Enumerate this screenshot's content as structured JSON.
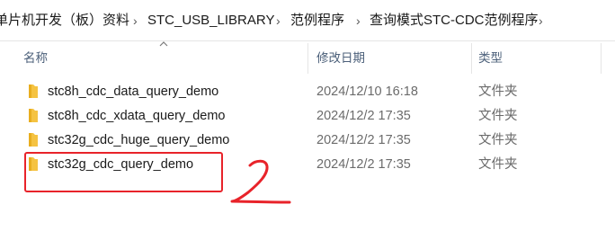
{
  "breadcrumb": {
    "items": [
      "单片机开发（板）资料",
      "STC_USB_LIBRARY",
      "范例程序",
      "查询模式STC-CDC范例程序"
    ],
    "separator": "›"
  },
  "columns": {
    "name": "名称",
    "date": "修改日期",
    "type": "类型"
  },
  "files": [
    {
      "name": "stc8h_cdc_data_query_demo",
      "date": "2024/12/10 16:18",
      "type": "文件夹"
    },
    {
      "name": "stc8h_cdc_xdata_query_demo",
      "date": "2024/12/2 17:35",
      "type": "文件夹"
    },
    {
      "name": "stc32g_cdc_huge_query_demo",
      "date": "2024/12/2 17:35",
      "type": "文件夹"
    },
    {
      "name": "stc32g_cdc_query_demo",
      "date": "2024/12/2 17:35",
      "type": "文件夹"
    }
  ],
  "annotation": {
    "text": "2",
    "color": "#e8232a"
  },
  "colors": {
    "folder": "#f5c342",
    "header_text": "#4c607a",
    "annotation_red": "#e8232a"
  }
}
